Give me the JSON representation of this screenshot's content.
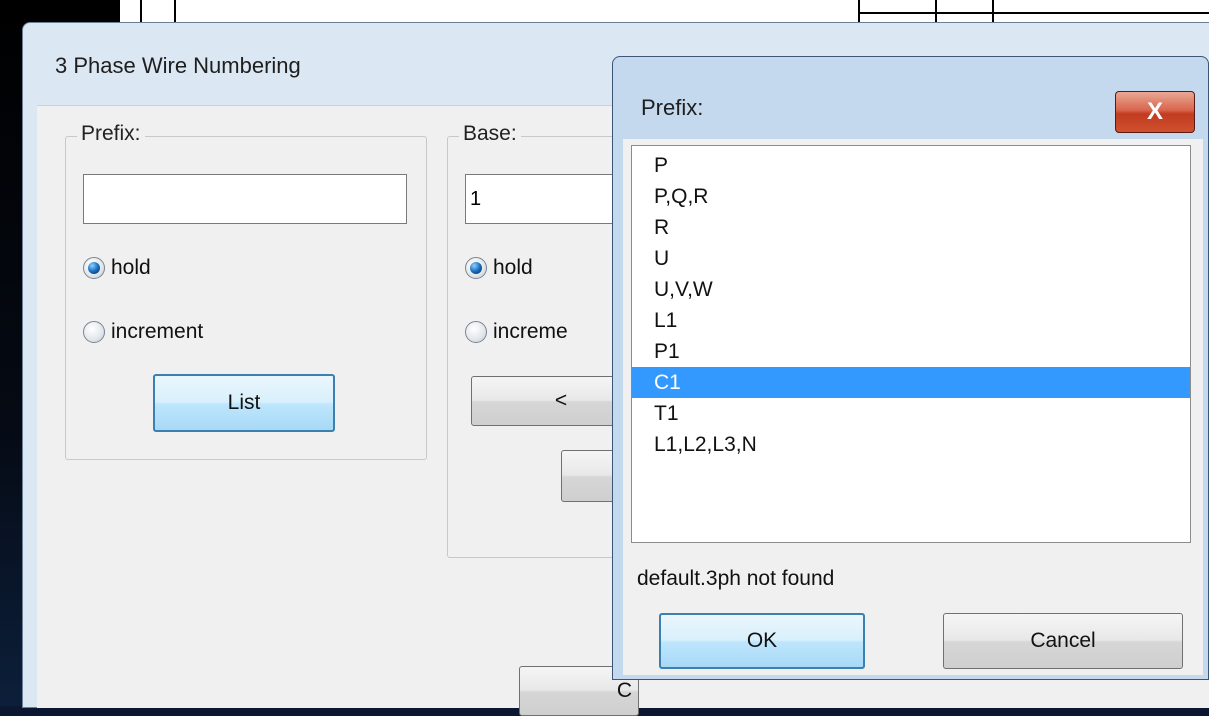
{
  "main_dialog": {
    "title": "3 Phase Wire Numbering",
    "prefix_group": {
      "label": "Prefix:",
      "input_value": "",
      "radio_hold": "hold",
      "radio_increment": "increment",
      "selected": "hold",
      "list_button": "List"
    },
    "base_group": {
      "label": "Base:",
      "input_value": "1",
      "radio_hold": "hold",
      "radio_increment": "increme",
      "selected": "hold",
      "prev_button": "<"
    },
    "bottom_button_partial": "C"
  },
  "prefix_popup": {
    "title": "Prefix:",
    "close_glyph": "X",
    "items": [
      "P",
      "P,Q,R",
      "R",
      "U",
      "U,V,W",
      "L1",
      "P1",
      "C1",
      "T1",
      "L1,L2,L3,N"
    ],
    "selected_index": 7,
    "status": "default.3ph not found",
    "ok_label": "OK",
    "cancel_label": "Cancel"
  }
}
